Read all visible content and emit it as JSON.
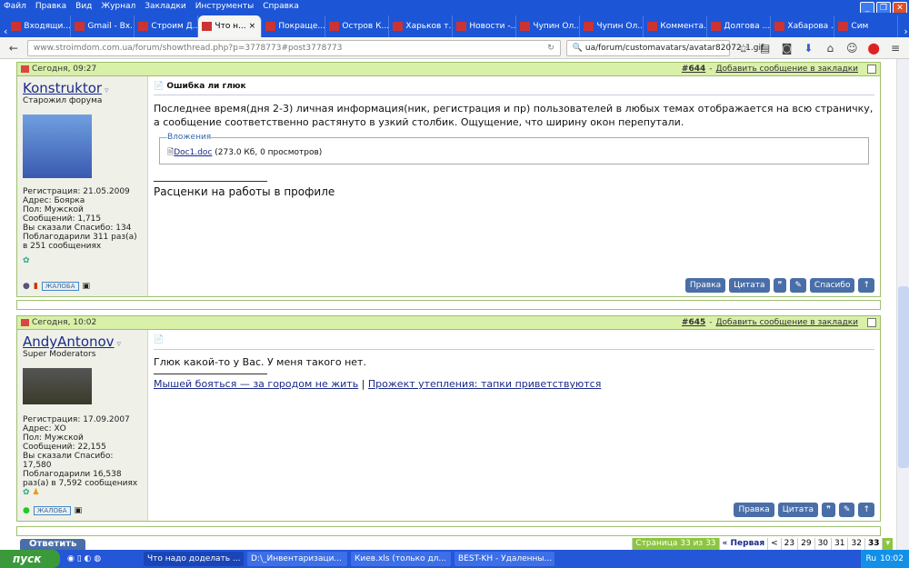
{
  "menu": [
    "Файл",
    "Правка",
    "Вид",
    "Журнал",
    "Закладки",
    "Инструменты",
    "Справка"
  ],
  "tabs": [
    "Входящи...",
    "Gmail - Вх...",
    "Строим Д...",
    "Что н...",
    "Покраще...",
    "Остров К...",
    "Харьков т...",
    "Новости -...",
    "Чупин Ол...",
    "Чупин Ол...",
    "Коммента...",
    "Долгова ...",
    "Хабарова ...",
    "Сим"
  ],
  "url": "www.stroimdom.com.ua/forum/showthread.php?p=3778773#post3778773",
  "search": "ua/forum/customavatars/avatar82072_1.gif",
  "posts": [
    {
      "date": "Сегодня, 09:27",
      "num": "#644",
      "bookmark": "Добавить сообщение в закладки",
      "user": "Konstruktor",
      "rank": "Старожил форума",
      "info": [
        "Регистрация: 21.05.2009",
        "Адрес: Боярка",
        "Пол: Мужской",
        "Сообщений: 1,715",
        "Вы сказали Спасибо: 134",
        "Поблагодарили 311 раз(а) в 251 сообщениях"
      ],
      "title": "Ошибка ли глюк",
      "text": "Последнее время(дня 2-3) личная информация(ник, регистрация и пр) пользователей в любых темах отображается на всю страничку, а сообщение соответственно растянуто в узкий столбик. Ощущение, что ширину окон перепутали.",
      "attach_label": "Вложения",
      "attach_file": "Doc1.doc",
      "attach_info": "(273.0 Кб, 0 просмотров)",
      "signature": "Расценки на работы в профиле"
    },
    {
      "date": "Сегодня, 10:02",
      "num": "#645",
      "bookmark": "Добавить сообщение в закладки",
      "user": "AndyAntonov",
      "rank": "Super Moderators",
      "info": [
        "Регистрация: 17.09.2007",
        "Адрес: ХО",
        "Пол: Мужской",
        "Сообщений: 22,155",
        "Вы сказали Спасибо: 17,580",
        "Поблагодарили 16,538 раз(а) в 7,592 сообщениях"
      ],
      "text": "Глюк какой-то у Вас. У меня такого нет.",
      "sig1": "Мышей бояться — за городом не жить",
      "sig_sep": "|",
      "sig2": "Прожект утепления: тапки приветствуются"
    }
  ],
  "report": "ЖАЛОБА",
  "buttons": {
    "edit": "Правка",
    "quote": "Цитата",
    "thanks": "Спасибо"
  },
  "reply": "Ответить",
  "pager": {
    "label": "Страница 33 из 33",
    "first": "« Первая",
    "prev": "<",
    "pages": [
      "23",
      "29",
      "30",
      "31",
      "32",
      "33"
    ]
  },
  "taskbar": {
    "start": "пуск",
    "items": [
      "Что надо доделать ...",
      "D:\\_Инвентаризаци...",
      "Киев.xls (только дл...",
      "BEST-KH - Удаленны..."
    ],
    "lang": "Ru",
    "clock": "10:02"
  }
}
